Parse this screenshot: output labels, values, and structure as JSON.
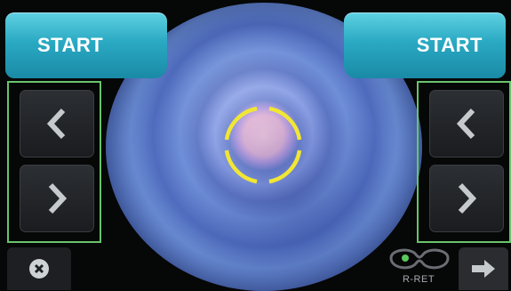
{
  "controls": {
    "start_left_label": "START",
    "start_right_label": "START",
    "eye_mode_label": "R-RET"
  },
  "colors": {
    "accent": "#2aa9c3",
    "highlight_border": "#69c46d",
    "target_ring": "#f1e634",
    "status_dot": "#58c85a"
  },
  "icons": {
    "left_prev": "chevron-left-icon",
    "left_next": "chevron-right-icon",
    "right_prev": "chevron-left-icon",
    "right_next": "chevron-right-icon",
    "close": "close-icon",
    "next": "arrow-right-icon",
    "eye_mode": "goggles-icon"
  }
}
